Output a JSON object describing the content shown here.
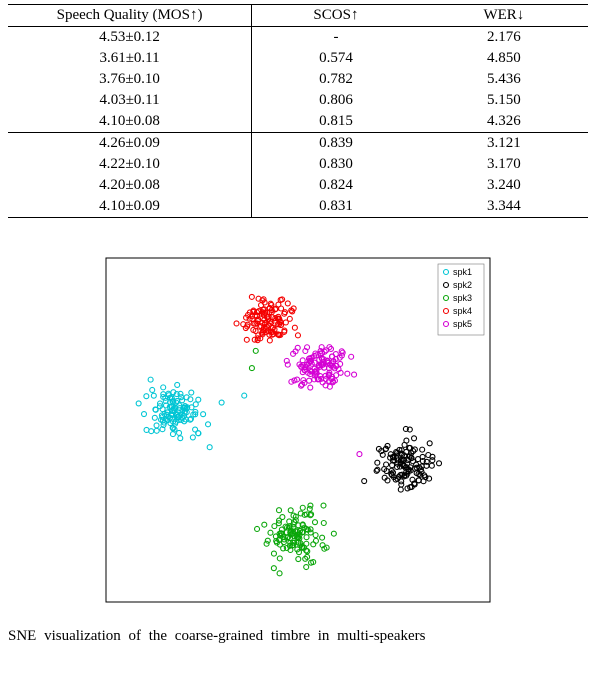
{
  "table": {
    "headers": {
      "mos": "Speech Quality (MOS↑)",
      "scos": "SCOS↑",
      "wer": "WER↓"
    },
    "rows_top": [
      {
        "mos": "4.53±0.12",
        "scos": "-",
        "wer": "2.176"
      },
      {
        "mos": "3.61±0.11",
        "scos": "0.574",
        "wer": "4.850"
      },
      {
        "mos": "3.76±0.10",
        "scos": "0.782",
        "wer": "5.436"
      },
      {
        "mos": "4.03±0.11",
        "scos": "0.806",
        "wer": "5.150"
      },
      {
        "mos": "4.10±0.08",
        "scos": "0.815",
        "wer": "4.326"
      }
    ],
    "rows_bottom": [
      {
        "mos": "4.26±0.09",
        "scos": "0.839",
        "wer": "3.121",
        "bold": true
      },
      {
        "mos": "4.22±0.10",
        "scos": "0.830",
        "wer": "3.170"
      },
      {
        "mos": "4.20±0.08",
        "scos": "0.824",
        "wer": "3.240"
      },
      {
        "mos": "4.10±0.09",
        "scos": "0.831",
        "wer": "3.344"
      }
    ]
  },
  "chart_data": {
    "type": "scatter",
    "title": "",
    "xlabel": "",
    "ylabel": "",
    "xlim": [
      0,
      100
    ],
    "ylim": [
      0,
      100
    ],
    "legend_position": "top-right",
    "series": [
      {
        "name": "spk1",
        "color": "#00c5d4",
        "cluster_center": [
          18,
          55
        ],
        "cluster_radius": 10,
        "n_points": 120,
        "outliers": [
          [
            36,
            60
          ],
          [
            27,
            45
          ]
        ]
      },
      {
        "name": "spk2",
        "color": "#000000",
        "cluster_center": [
          78,
          40
        ],
        "cluster_radius": 10,
        "n_points": 120,
        "outliers": []
      },
      {
        "name": "spk3",
        "color": "#0aa60a",
        "cluster_center": [
          49,
          19
        ],
        "cluster_radius": 10,
        "n_points": 120,
        "outliers": [
          [
            38,
            68
          ],
          [
            39,
            73
          ]
        ]
      },
      {
        "name": "spk4",
        "color": "#f40000",
        "cluster_center": [
          42,
          82
        ],
        "cluster_radius": 9,
        "n_points": 120,
        "outliers": []
      },
      {
        "name": "spk5",
        "color": "#d400d4",
        "cluster_center": [
          56,
          68
        ],
        "cluster_radius": 10,
        "n_points": 120,
        "outliers": [
          [
            66,
            43
          ]
        ]
      }
    ]
  },
  "caption": "SNE visualization of the coarse-grained timbre in multi-speakers",
  "legend": {
    "items": [
      "spk1",
      "spk2",
      "spk3",
      "spk4",
      "spk5"
    ]
  }
}
